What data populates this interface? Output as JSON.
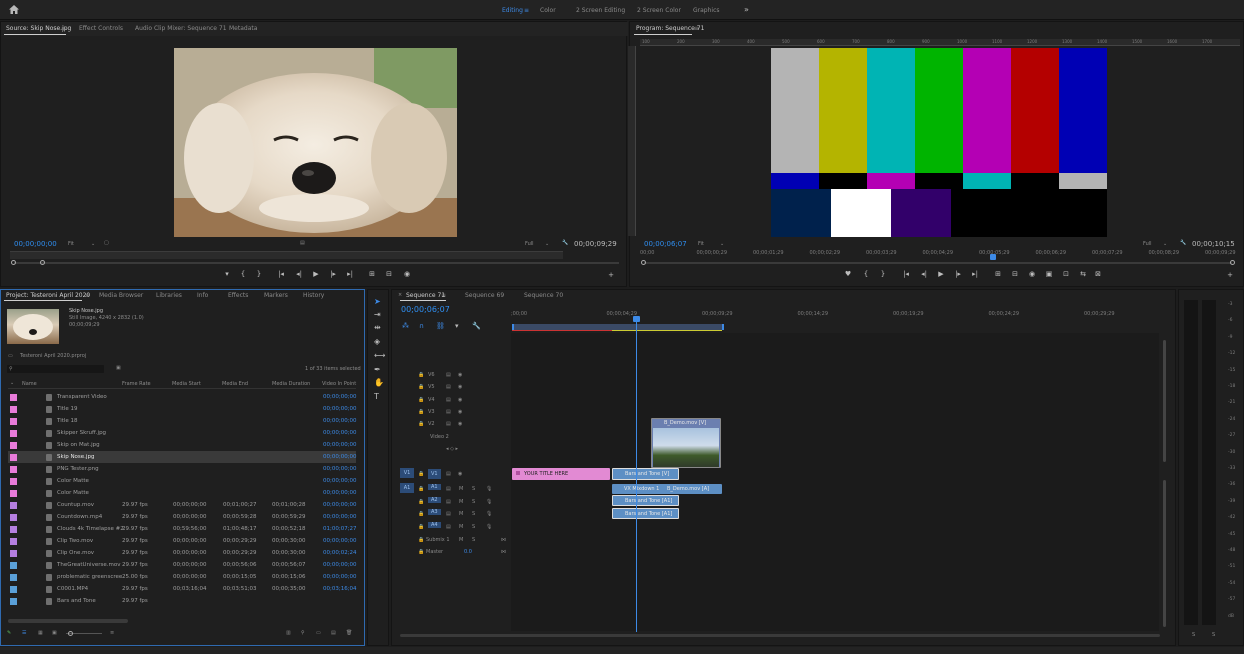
{
  "workspaces": [
    "Editing",
    "Color",
    "2 Screen Editing",
    "2 Screen Color",
    "Graphics"
  ],
  "source": {
    "tabs": [
      "Source: Skip Nose.jpg",
      "Effect Controls",
      "Audio Clip Mixer: Sequence 71",
      "Metadata"
    ],
    "timecode": "00;00;00;00",
    "zoom": "Fit",
    "quality": "Full",
    "duration": "00;00;09;29"
  },
  "program": {
    "tab": "Program: Sequence 71",
    "timecode": "00;00;06;07",
    "zoom": "Fit",
    "quality": "Full",
    "duration": "00;00;10;15",
    "ruler": [
      "00;00",
      "00;00;00;29",
      "00;00;01;29",
      "00;00;02;29",
      "00;00;03;29",
      "00;00;04;29",
      "00;00;05;29",
      "00;00;06;29",
      "00;00;07;29",
      "00;00;08;29",
      "00;00;09;29"
    ],
    "top_ruler": [
      "100",
      "200",
      "300",
      "400",
      "500",
      "600",
      "700",
      "800",
      "900",
      "1000",
      "1100",
      "1200",
      "1300",
      "1400",
      "1500",
      "1600",
      "1700"
    ],
    "bars_colors": [
      "#b4b4b4",
      "#b4b400",
      "#00b4b4",
      "#00b400",
      "#b400b4",
      "#b40000",
      "#0000b4"
    ],
    "mid_colors": [
      "#0000b4",
      "#000000",
      "#b400b4",
      "#000000",
      "#00b4b4",
      "#000000",
      "#b4b4b4"
    ],
    "low_colors": [
      "#00214c",
      "#ffffff",
      "#32006a",
      "#000000"
    ]
  },
  "project": {
    "tabs": [
      "Project: Testeroni April 2020",
      "Media Browser",
      "Libraries",
      "Info",
      "Effects",
      "Markers",
      "History"
    ],
    "preview_name": "Skip Nose.jpg",
    "preview_info": "Still Image, 4240 x 2832 (1.0)",
    "preview_dur": "00;00;09;29",
    "project_file": "Testeroni April 2020.prproj",
    "items_selected": "1 of 33 items selected",
    "columns": [
      "Name",
      "Frame Rate",
      "Media Start",
      "Media End",
      "Media Duration",
      "Video In Point"
    ],
    "rows": [
      {
        "name": "Transparent Video",
        "fr": "",
        "ms": "",
        "me": "",
        "md": "",
        "vi": "00;00;00;00",
        "color": "#e87bd9",
        "sel": false
      },
      {
        "name": "Title 19",
        "fr": "",
        "ms": "",
        "me": "",
        "md": "",
        "vi": "00;00;00;00",
        "color": "#e87bd9",
        "sel": false
      },
      {
        "name": "Title 18",
        "fr": "",
        "ms": "",
        "me": "",
        "md": "",
        "vi": "00;00;00;00",
        "color": "#e87bd9",
        "sel": false
      },
      {
        "name": "Skipper Skruff.jpg",
        "fr": "",
        "ms": "",
        "me": "",
        "md": "",
        "vi": "00;00;00;00",
        "color": "#e87bd9",
        "sel": false
      },
      {
        "name": "Skip on Mat.jpg",
        "fr": "",
        "ms": "",
        "me": "",
        "md": "",
        "vi": "00;00;00;00",
        "color": "#e87bd9",
        "sel": false
      },
      {
        "name": "Skip Nose.jpg",
        "fr": "",
        "ms": "",
        "me": "",
        "md": "",
        "vi": "00;00;00;00",
        "color": "#e87bd9",
        "sel": true
      },
      {
        "name": "PNG Tester.png",
        "fr": "",
        "ms": "",
        "me": "",
        "md": "",
        "vi": "00;00;00;00",
        "color": "#e87bd9",
        "sel": false
      },
      {
        "name": "Color Matte",
        "fr": "",
        "ms": "",
        "me": "",
        "md": "",
        "vi": "00;00;00;00",
        "color": "#e87bd9",
        "sel": false
      },
      {
        "name": "Color Matte",
        "fr": "",
        "ms": "",
        "me": "",
        "md": "",
        "vi": "00;00;00;00",
        "color": "#e87bd9",
        "sel": false
      },
      {
        "name": "Countup.mov",
        "fr": "29.97 fps",
        "ms": "00;00;00;00",
        "me": "00;01;00;27",
        "md": "00;01;00;28",
        "vi": "00;00;00;00",
        "color": "#b57fe0",
        "sel": false
      },
      {
        "name": "Countdown.mp4",
        "fr": "29.97 fps",
        "ms": "00;00;00;00",
        "me": "00;00;59;28",
        "md": "00;00;59;29",
        "vi": "00;00;00;00",
        "color": "#b57fe0",
        "sel": false
      },
      {
        "name": "Clouds 4k Timelapse #2.",
        "fr": "29.97 fps",
        "ms": "00;59;56;00",
        "me": "01;00;48;17",
        "md": "00;00;52;18",
        "vi": "01;00;07;27",
        "color": "#b57fe0",
        "sel": false
      },
      {
        "name": "Clip Two.mov",
        "fr": "29.97 fps",
        "ms": "00;00;00;00",
        "me": "00;00;29;29",
        "md": "00;00;30;00",
        "vi": "00;00;00;00",
        "color": "#b57fe0",
        "sel": false
      },
      {
        "name": "Clip One.mov",
        "fr": "29.97 fps",
        "ms": "00;00;00;00",
        "me": "00;00;29;29",
        "md": "00;00;30;00",
        "vi": "00;00;02;24",
        "color": "#b57fe0",
        "sel": false
      },
      {
        "name": "TheGreatUniverse.mov",
        "fr": "29.97 fps",
        "ms": "00;00;00;00",
        "me": "00;00;56;06",
        "md": "00;00;56;07",
        "vi": "00;00;00;00",
        "color": "#5aa0d8",
        "sel": false
      },
      {
        "name": "problematic greenscree",
        "fr": "25.00 fps",
        "ms": "00;00;00;00",
        "me": "00;00;15;05",
        "md": "00;00;15;06",
        "vi": "00;00;00;00",
        "color": "#5aa0d8",
        "sel": false
      },
      {
        "name": "C0001.MP4",
        "fr": "29.97 fps",
        "ms": "00;03;16;04",
        "me": "00;03;51;03",
        "md": "00;00;35;00",
        "vi": "00;03;16;04",
        "color": "#5aa0d8",
        "sel": false
      },
      {
        "name": "Bars and Tone",
        "fr": "29.97 fps",
        "ms": "",
        "me": "",
        "md": "",
        "vi": "",
        "color": "#5aa0d8",
        "sel": false
      }
    ]
  },
  "timeline": {
    "tabs": [
      "Sequence 71",
      "Sequence 69",
      "Sequence 70"
    ],
    "timecode": "00;00;06;07",
    "ruler": [
      ";00;00",
      "00;00;04;29",
      "00;00;09;29",
      "00;00;14;29",
      "00;00;19;29",
      "00;00;24;29",
      "00;00;29;29"
    ],
    "video_tracks": [
      "V6",
      "V5",
      "V4",
      "V3",
      "V2",
      "V1"
    ],
    "v2_name": "Video 2",
    "audio_tracks": [
      "A1",
      "A2",
      "A3",
      "A4"
    ],
    "src_v1": "V1",
    "src_a1": "A1",
    "mix_labels": [
      "M",
      "S"
    ],
    "submix": "Submix 1",
    "master": "Master",
    "master_val": "0.0",
    "clips": {
      "title": "YOUR TITLE HERE",
      "bars_v": "Bars and Tone [V]",
      "demo_v": "B_Demo.mov [V]",
      "mix_a": "VX Mixdown 1",
      "demo_a": "B_Demo.mov [A]",
      "bars_a1": "Bars and Tone [A1]",
      "bars_a2": "Bars and Tone [A1]"
    }
  },
  "meter": {
    "scale": [
      "-3",
      "-6",
      "-9",
      "-12",
      "-15",
      "-18",
      "-21",
      "-24",
      "-27",
      "-30",
      "-33",
      "-36",
      "-39",
      "-42",
      "-45",
      "-48",
      "-51",
      "-54",
      "-57",
      "dB"
    ],
    "l": "S",
    "r": "S"
  }
}
